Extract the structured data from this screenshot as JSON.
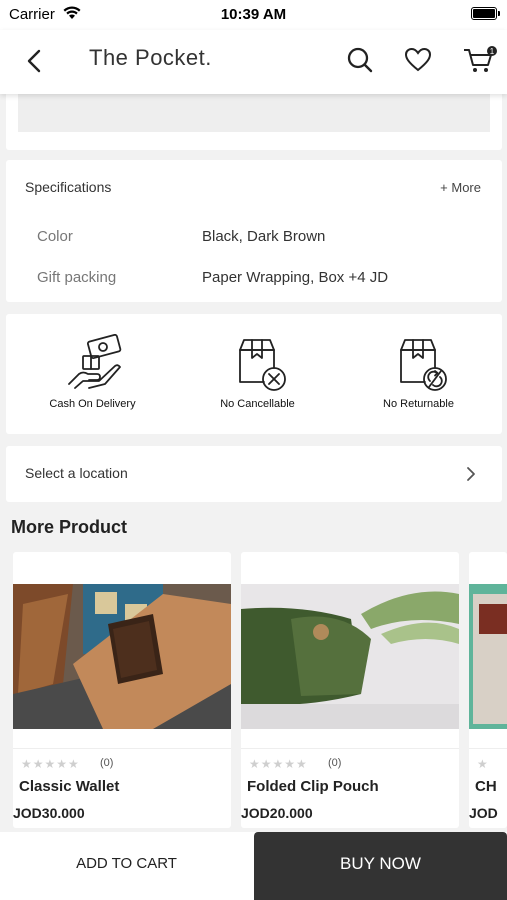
{
  "status_bar": {
    "carrier": "Carrier",
    "time": "10:39 AM"
  },
  "header": {
    "title": "The Pocket.",
    "cart_badge": "1"
  },
  "specifications": {
    "title": "Specifications",
    "more_label": "+ More",
    "rows": [
      {
        "key": "Color",
        "value": "Black, Dark Brown"
      },
      {
        "key": "Gift packing",
        "value": "Paper Wrapping, Box +4 JD"
      }
    ]
  },
  "policies": [
    {
      "label": "Cash On Delivery",
      "icon": "cash-on-delivery-icon"
    },
    {
      "label": "No Cancellable",
      "icon": "no-cancel-icon"
    },
    {
      "label": "No Returnable",
      "icon": "no-return-icon"
    }
  ],
  "location": {
    "label": "Select a location"
  },
  "more_products": {
    "title": "More Product",
    "items": [
      {
        "name": "Classic Wallet",
        "price": "JOD30.000",
        "rating_count": "(0)",
        "stars": "★★★★★"
      },
      {
        "name": "Folded Clip Pouch",
        "price": "JOD20.000",
        "rating_count": "(0)",
        "stars": "★★★★★"
      },
      {
        "name": "CH",
        "price": "JOD",
        "rating_count": "",
        "stars": "★"
      }
    ]
  },
  "actions": {
    "add_to_cart": "ADD TO CART",
    "buy_now": "BUY NOW"
  },
  "colors": {
    "buy_now_bg": "#333333",
    "background": "#f2f2f2",
    "card": "#ffffff"
  }
}
